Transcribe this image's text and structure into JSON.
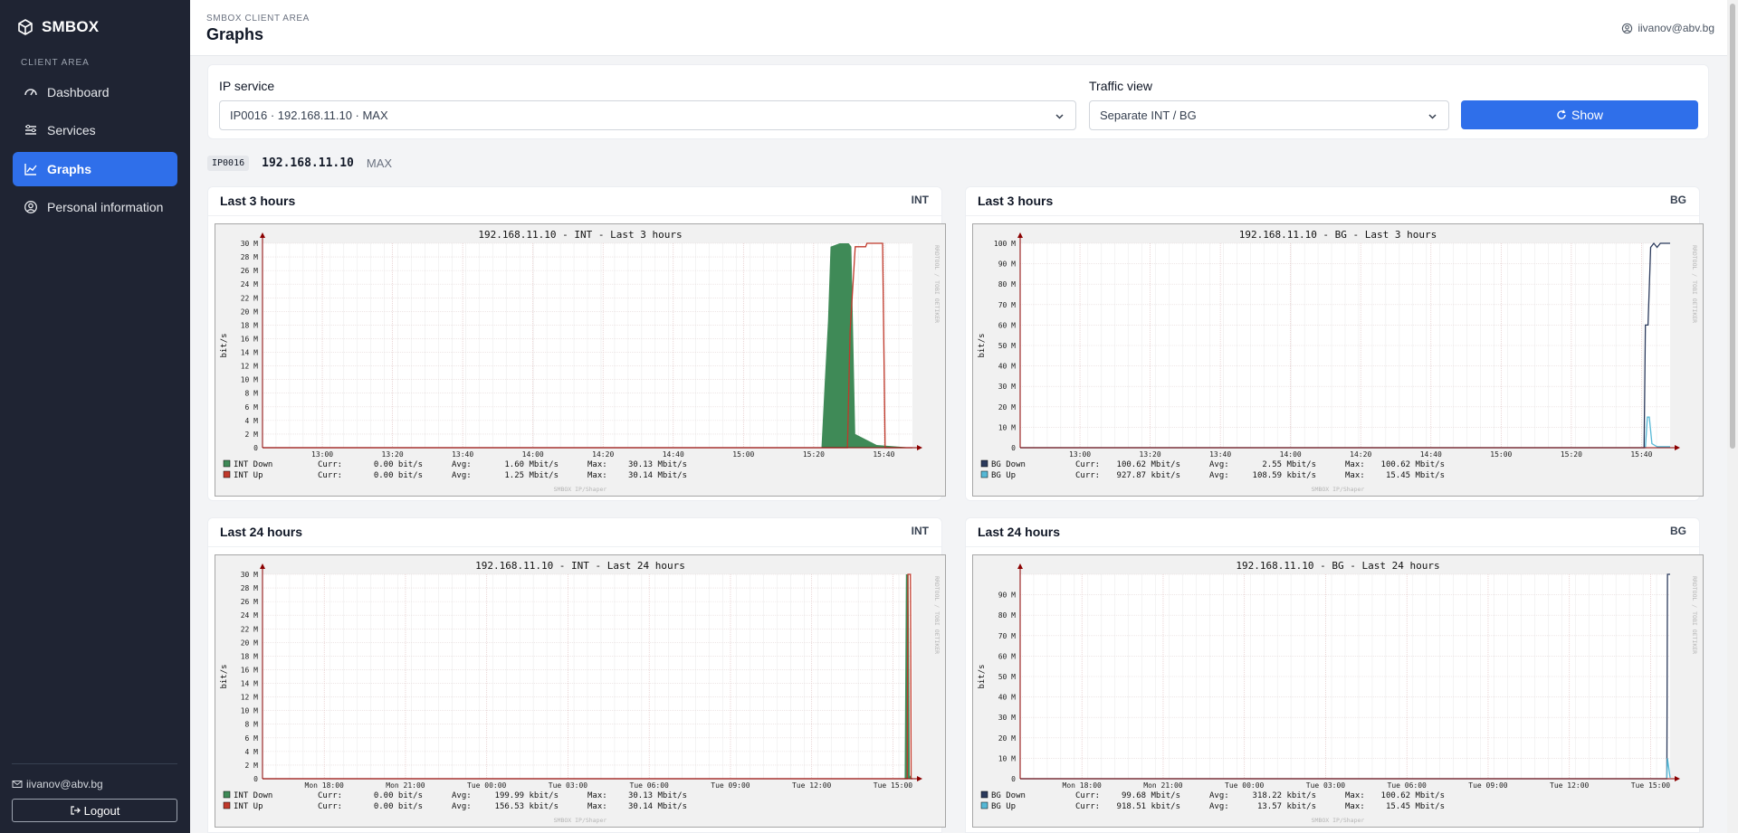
{
  "sidebar": {
    "brand": "SMBOX",
    "section_label": "CLIENT AREA",
    "items": [
      {
        "label": "Dashboard",
        "icon": "gauge-icon"
      },
      {
        "label": "Services",
        "icon": "sliders-icon"
      },
      {
        "label": "Graphs",
        "icon": "chart-line-icon",
        "active": true
      },
      {
        "label": "Personal information",
        "icon": "user-circle-icon"
      }
    ],
    "user_email": "iivanov@abv.bg",
    "logout_label": "Logout"
  },
  "header": {
    "breadcrumb": "SMBOX CLIENT AREA",
    "title": "Graphs",
    "user_email": "iivanov@abv.bg"
  },
  "filters": {
    "service_label": "IP service",
    "service_value": "IP0016 · 192.168.11.10 · MAX",
    "view_label": "Traffic view",
    "view_value": "Separate INT / BG",
    "show_label": "Show"
  },
  "service": {
    "id": "IP0016",
    "ip": "192.168.11.10",
    "plan": "MAX"
  },
  "colors": {
    "accent": "#2f6fea",
    "sidebar": "#1f2433",
    "int_down": "#3f8a57",
    "int_up": "#c0392b",
    "bg_down": "#2b3a5c",
    "bg_up": "#56b8d6"
  },
  "chart_data": [
    {
      "type": "area",
      "card_title": "Last 3 hours",
      "tag": "INT",
      "title": "192.168.11.10 - INT - Last 3 hours",
      "ylabel": "bit/s",
      "side_text": "RRDTOOL / TOBI OETIKER",
      "footer": "SMBOX IP/Shaper",
      "yticks": [
        "30 M",
        "28 M",
        "26 M",
        "24 M",
        "22 M",
        "20 M",
        "18 M",
        "16 M",
        "14 M",
        "12 M",
        "10 M",
        "8 M",
        "6 M",
        "4 M",
        "2 M",
        "0"
      ],
      "ymax": 30,
      "xticks": [
        {
          "label": "13:00",
          "x": 0.092
        },
        {
          "label": "13:20",
          "x": 0.2
        },
        {
          "label": "13:40",
          "x": 0.308
        },
        {
          "label": "14:00",
          "x": 0.416
        },
        {
          "label": "14:20",
          "x": 0.524
        },
        {
          "label": "14:40",
          "x": 0.632
        },
        {
          "label": "15:00",
          "x": 0.74
        },
        {
          "label": "15:20",
          "x": 0.848
        },
        {
          "label": "15:40",
          "x": 0.956
        }
      ],
      "series": [
        {
          "name": "INT Down",
          "kind": "area",
          "color": "#3f8a57",
          "points": [
            [
              0,
              0
            ],
            [
              0.86,
              0
            ],
            [
              0.865,
              9.6
            ],
            [
              0.87,
              18.6
            ],
            [
              0.874,
              29.5
            ],
            [
              0.888,
              30
            ],
            [
              0.902,
              30
            ],
            [
              0.906,
              29.5
            ],
            [
              0.912,
              2
            ],
            [
              0.945,
              0.4
            ],
            [
              1,
              0
            ]
          ],
          "stats": {
            "curr": "0.00  bit/s",
            "avg": "1.60 Mbit/s",
            "max": "30.13 Mbit/s"
          }
        },
        {
          "name": "INT Up",
          "kind": "line",
          "color": "#c0392b",
          "points": [
            [
              0,
              0
            ],
            [
              0.9,
              0
            ],
            [
              0.904,
              17
            ],
            [
              0.912,
              29.5
            ],
            [
              0.928,
              29.5
            ],
            [
              0.93,
              30
            ],
            [
              0.954,
              30
            ],
            [
              0.958,
              0
            ],
            [
              1,
              0
            ]
          ],
          "stats": {
            "curr": "0.00  bit/s",
            "avg": "1.25 Mbit/s",
            "max": "30.14 Mbit/s"
          }
        }
      ]
    },
    {
      "type": "area",
      "card_title": "Last 3 hours",
      "tag": "BG",
      "title": "192.168.11.10 - BG - Last 3 hours",
      "ylabel": "bit/s",
      "side_text": "RRDTOOL / TOBI OETIKER",
      "footer": "SMBOX IP/Shaper",
      "yticks": [
        "100 M",
        "90 M",
        "80 M",
        "70 M",
        "60 M",
        "50 M",
        "40 M",
        "30 M",
        "20 M",
        "10 M",
        "0"
      ],
      "ymax": 100,
      "xticks": [
        {
          "label": "13:00",
          "x": 0.092
        },
        {
          "label": "13:20",
          "x": 0.2
        },
        {
          "label": "13:40",
          "x": 0.308
        },
        {
          "label": "14:00",
          "x": 0.416
        },
        {
          "label": "14:20",
          "x": 0.524
        },
        {
          "label": "14:40",
          "x": 0.632
        },
        {
          "label": "15:00",
          "x": 0.74
        },
        {
          "label": "15:20",
          "x": 0.848
        },
        {
          "label": "15:40",
          "x": 0.956
        }
      ],
      "series": [
        {
          "name": "BG Down",
          "kind": "line",
          "color": "#2b3a5c",
          "points": [
            [
              0,
              0
            ],
            [
              0.96,
              0
            ],
            [
              0.962,
              60
            ],
            [
              0.966,
              60
            ],
            [
              0.97,
              98
            ],
            [
              0.975,
              100
            ],
            [
              0.98,
              98
            ],
            [
              0.985,
              100
            ],
            [
              0.995,
              100
            ],
            [
              1,
              100
            ]
          ],
          "stats": {
            "curr": "100.62 Mbit/s",
            "avg": "2.55 Mbit/s",
            "max": "100.62 Mbit/s"
          }
        },
        {
          "name": "BG Up",
          "kind": "line",
          "color": "#56b8d6",
          "points": [
            [
              0,
              0
            ],
            [
              0.962,
              0
            ],
            [
              0.965,
              15
            ],
            [
              0.968,
              15
            ],
            [
              0.972,
              2
            ],
            [
              0.98,
              0.5
            ],
            [
              1,
              0.5
            ]
          ],
          "stats": {
            "curr": "927.87 kbit/s",
            "avg": "108.59 kbit/s",
            "max": "15.45 Mbit/s"
          }
        }
      ]
    },
    {
      "type": "area",
      "card_title": "Last 24 hours",
      "tag": "INT",
      "title": "192.168.11.10 - INT - Last 24 hours",
      "ylabel": "bit/s",
      "side_text": "RRDTOOL / TOBI OETIKER",
      "footer": "SMBOX IP/Shaper",
      "yticks": [
        "30 M",
        "28 M",
        "26 M",
        "24 M",
        "22 M",
        "20 M",
        "18 M",
        "16 M",
        "14 M",
        "12 M",
        "10 M",
        "8 M",
        "6 M",
        "4 M",
        "2 M",
        "0"
      ],
      "ymax": 30,
      "xticks": [
        {
          "label": "Mon 18:00",
          "x": 0.095
        },
        {
          "label": "Mon 21:00",
          "x": 0.22
        },
        {
          "label": "Tue 00:00",
          "x": 0.345
        },
        {
          "label": "Tue 03:00",
          "x": 0.47
        },
        {
          "label": "Tue 06:00",
          "x": 0.595
        },
        {
          "label": "Tue 09:00",
          "x": 0.72
        },
        {
          "label": "Tue 12:00",
          "x": 0.845
        },
        {
          "label": "Tue 15:00",
          "x": 0.97
        }
      ],
      "series": [
        {
          "name": "INT Down",
          "kind": "area",
          "color": "#3f8a57",
          "points": [
            [
              0,
              0
            ],
            [
              0.988,
              0
            ],
            [
              0.99,
              30
            ],
            [
              0.994,
              30
            ],
            [
              0.996,
              0.5
            ],
            [
              1,
              0
            ]
          ],
          "stats": {
            "curr": "0.00  bit/s",
            "avg": "199.99 kbit/s",
            "max": "30.13 Mbit/s"
          }
        },
        {
          "name": "INT Up",
          "kind": "line",
          "color": "#c0392b",
          "points": [
            [
              0,
              0
            ],
            [
              0.992,
              0
            ],
            [
              0.993,
              30
            ],
            [
              0.997,
              30
            ],
            [
              0.998,
              0
            ],
            [
              1,
              0
            ]
          ],
          "stats": {
            "curr": "0.00  bit/s",
            "avg": "156.53 kbit/s",
            "max": "30.14 Mbit/s"
          }
        }
      ]
    },
    {
      "type": "area",
      "card_title": "Last 24 hours",
      "tag": "BG",
      "title": "192.168.11.10 - BG - Last 24 hours",
      "ylabel": "bit/s",
      "side_text": "RRDTOOL / TOBI OETIKER",
      "footer": "SMBOX IP/Shaper",
      "yticks": [
        "",
        "90 M",
        "80 M",
        "70 M",
        "60 M",
        "50 M",
        "40 M",
        "30 M",
        "20 M",
        "10 M",
        "0"
      ],
      "ymax": 100,
      "xticks": [
        {
          "label": "Mon 18:00",
          "x": 0.095
        },
        {
          "label": "Mon 21:00",
          "x": 0.22
        },
        {
          "label": "Tue 00:00",
          "x": 0.345
        },
        {
          "label": "Tue 03:00",
          "x": 0.47
        },
        {
          "label": "Tue 06:00",
          "x": 0.595
        },
        {
          "label": "Tue 09:00",
          "x": 0.72
        },
        {
          "label": "Tue 12:00",
          "x": 0.845
        },
        {
          "label": "Tue 15:00",
          "x": 0.97
        }
      ],
      "series": [
        {
          "name": "BG Down",
          "kind": "line",
          "color": "#2b3a5c",
          "points": [
            [
              0,
              0
            ],
            [
              0.995,
              0
            ],
            [
              0.996,
              100
            ],
            [
              1,
              100
            ]
          ],
          "stats": {
            "curr": "99.68 Mbit/s",
            "avg": "318.22 kbit/s",
            "max": "100.62 Mbit/s"
          }
        },
        {
          "name": "BG Up",
          "kind": "line",
          "color": "#56b8d6",
          "points": [
            [
              0,
              0
            ],
            [
              0.995,
              0
            ],
            [
              0.996,
              10
            ],
            [
              1,
              0.5
            ]
          ],
          "stats": {
            "curr": "918.51 kbit/s",
            "avg": "13.57 kbit/s",
            "max": "15.45 Mbit/s"
          }
        }
      ]
    }
  ]
}
